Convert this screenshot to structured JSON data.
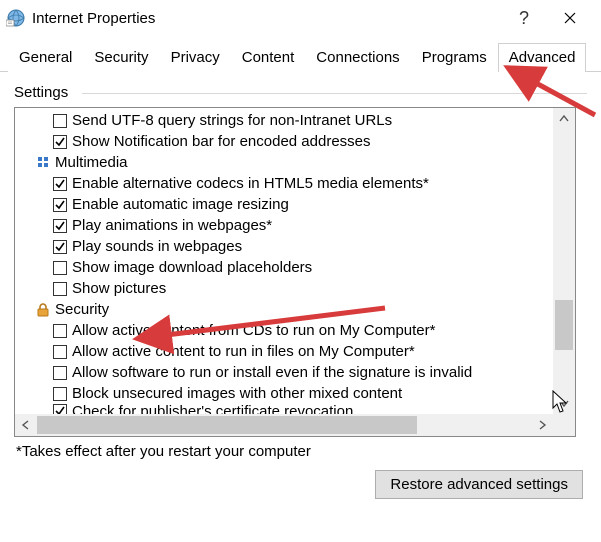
{
  "window": {
    "title": "Internet Properties",
    "help_label": "?",
    "close_label": "×"
  },
  "tabs": [
    {
      "label": "General"
    },
    {
      "label": "Security"
    },
    {
      "label": "Privacy"
    },
    {
      "label": "Content"
    },
    {
      "label": "Connections"
    },
    {
      "label": "Programs"
    },
    {
      "label": "Advanced",
      "active": true
    }
  ],
  "group_label": "Settings",
  "items": [
    {
      "type": "check",
      "checked": false,
      "label": "Send UTF-8 query strings for non-Intranet URLs"
    },
    {
      "type": "check",
      "checked": true,
      "label": "Show Notification bar for encoded addresses"
    },
    {
      "type": "category",
      "icon": "multimedia",
      "label": "Multimedia"
    },
    {
      "type": "check",
      "checked": true,
      "label": "Enable alternative codecs in HTML5 media elements*"
    },
    {
      "type": "check",
      "checked": true,
      "label": "Enable automatic image resizing"
    },
    {
      "type": "check",
      "checked": true,
      "label": "Play animations in webpages*"
    },
    {
      "type": "check",
      "checked": true,
      "label": "Play sounds in webpages"
    },
    {
      "type": "check",
      "checked": false,
      "label": "Show image download placeholders"
    },
    {
      "type": "check",
      "checked": false,
      "label": "Show pictures"
    },
    {
      "type": "category",
      "icon": "security",
      "label": "Security"
    },
    {
      "type": "check",
      "checked": false,
      "label": "Allow active content from CDs to run on My Computer*"
    },
    {
      "type": "check",
      "checked": false,
      "label": "Allow active content to run in files on My Computer*"
    },
    {
      "type": "check",
      "checked": false,
      "label": "Allow software to run or install even if the signature is invalid"
    },
    {
      "type": "check",
      "checked": false,
      "label": "Block unsecured images with other mixed content"
    },
    {
      "type": "check",
      "checked": true,
      "label": "Check for publisher's certificate revocation",
      "cut": true
    }
  ],
  "footnote": "*Takes effect after you restart your computer",
  "restore_button": "Restore advanced settings",
  "colors": {
    "annotation": "#d83b3b"
  }
}
